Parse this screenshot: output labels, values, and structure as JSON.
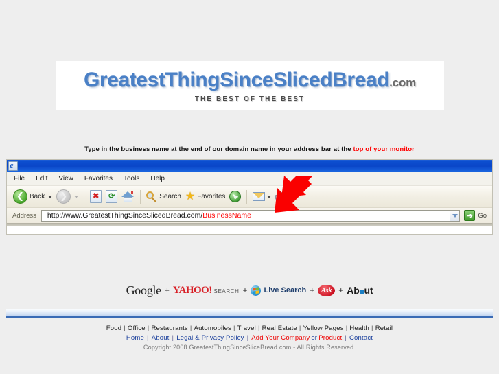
{
  "logo": {
    "main_text": "GreatestThingSinceSlicedBread",
    "tld": ".com",
    "tagline": "THE BEST OF THE BEST",
    "color": "#4a80c6"
  },
  "instruction": {
    "text": "Type in the business name at the end of our domain name in your address bar at the ",
    "highlight": "top of your monitor",
    "highlight_color": "#ff0000"
  },
  "browser": {
    "title": "",
    "icon": "internet-explorer-icon",
    "menu": [
      {
        "label": "File"
      },
      {
        "label": "Edit"
      },
      {
        "label": "View"
      },
      {
        "label": "Favorites"
      },
      {
        "label": "Tools"
      },
      {
        "label": "Help"
      }
    ],
    "toolbar": {
      "back_label": "Back",
      "forward_label": "",
      "stop_glyph": "✖",
      "refresh_glyph": "↻",
      "search_label": "Search",
      "favorites_label": "Favorites",
      "icons": [
        "back-arrow-icon",
        "forward-arrow-icon",
        "stop-icon",
        "refresh-icon",
        "home-icon",
        "search-icon",
        "favorites-star-icon",
        "media-icon",
        "mail-icon",
        "print-icon"
      ]
    },
    "address": {
      "label": "Address",
      "url_prefix": "http://www.GreatestThingSinceSlicedBread.com/",
      "url_placeholder_text": "BusinessName",
      "url_placeholder_color": "#ff0000",
      "go_label": "Go"
    }
  },
  "annotation": {
    "arrow": "red-down-left-arrow",
    "color": "#fa0000"
  },
  "search_engines": {
    "separator": "+",
    "items": [
      {
        "name": "Google",
        "label": "Google"
      },
      {
        "name": "Yahoo Search",
        "label": "YAHOO!",
        "sub_label": "SEARCH"
      },
      {
        "name": "Live Search",
        "label": "Live Search"
      },
      {
        "name": "Ask",
        "label": "Ask"
      },
      {
        "name": "About",
        "label_before": "Ab",
        "label_after": "ut"
      }
    ]
  },
  "footer": {
    "categories": [
      "Food",
      "Office",
      "Restaurants",
      "Automobiles",
      "Travel",
      "Real Estate",
      "Yellow Pages",
      "Health",
      "Retail"
    ],
    "category_divider": "|",
    "links": [
      {
        "label": "Home",
        "color": "blue"
      },
      {
        "label": "About",
        "color": "blue"
      },
      {
        "label": "Legal & Privacy Policy",
        "color": "blue"
      },
      {
        "label": "Add Your Company",
        "color": "red"
      },
      {
        "label": "Product",
        "color": "red"
      },
      {
        "label": "Contact",
        "color": "blue"
      }
    ],
    "link_divider": "|",
    "conjunction": "or",
    "copyright": "Copyright 2008 GreatestThingSinceSliceBread.com - All Rights Reserved."
  }
}
